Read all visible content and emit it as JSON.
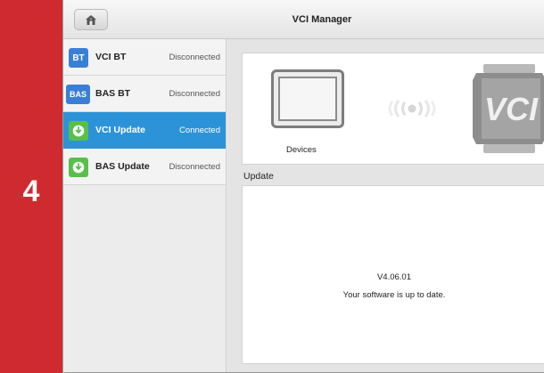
{
  "step": {
    "number": "4"
  },
  "window": {
    "title": "VCI Manager"
  },
  "icons": {
    "home": "home-icon",
    "bluetooth_badge": "BT",
    "bas_badge": "BAS",
    "download": "download-icon"
  },
  "colors": {
    "step_strip": "#cf2a2f",
    "active_row": "#2d93d8",
    "bt_badge": "#3a7fd6",
    "update_badge": "#58c04a"
  },
  "sidebar": {
    "items": [
      {
        "badge": "BT",
        "label": "VCI BT",
        "status": "Disconnected",
        "active": false
      },
      {
        "badge": "BAS",
        "label": "BAS BT",
        "status": "Disconnected",
        "active": false
      },
      {
        "badge": "download-icon",
        "label": "VCI Update",
        "status": "Connected",
        "active": true
      },
      {
        "badge": "download-icon",
        "label": "BAS Update",
        "status": "Disconnected",
        "active": false
      }
    ]
  },
  "devices_panel": {
    "label": "Devices",
    "vci_logo_text": "VCI"
  },
  "update": {
    "header": "Update",
    "version": "V4.06.01",
    "message": "Your software is up to date."
  }
}
